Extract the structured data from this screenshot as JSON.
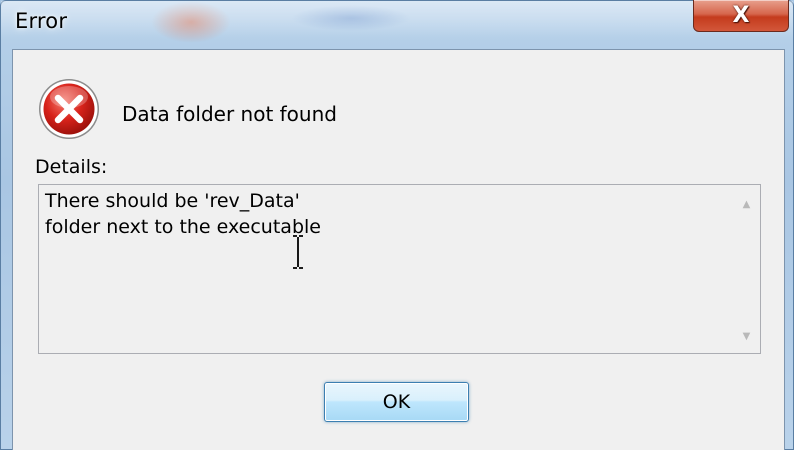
{
  "window": {
    "title": "Error",
    "close_glyph": "X",
    "close_icon": "close-icon"
  },
  "dialog": {
    "icon": "error-icon",
    "message": "Data folder not found",
    "details_label": "Details:",
    "details_text_line1": "There should be 'rev_Data'",
    "details_text_line2": "folder next to the executable",
    "ok_label": "OK"
  },
  "colors": {
    "error_red": "#d32f2f",
    "button_border": "#3c7fb1",
    "client_bg": "#f0f0f0",
    "close_red": "#c43b1d"
  }
}
